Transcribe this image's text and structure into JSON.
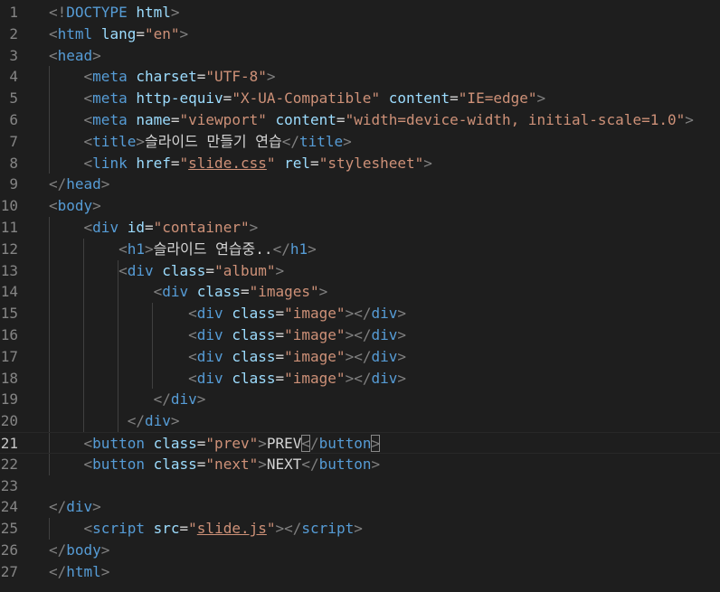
{
  "editor": {
    "language": "html",
    "active_line": 21,
    "colors": {
      "background": "#1e1e1e",
      "line_number": "#858585",
      "tag": "#569cd6",
      "attribute": "#9cdcfe",
      "string": "#ce9178",
      "punctuation": "#808080",
      "text": "#d4d4d4"
    },
    "lines": [
      {
        "number": "1",
        "tokens": [
          [
            "pun",
            "<!"
          ],
          [
            "tag",
            "DOCTYPE"
          ],
          [
            "text",
            " "
          ],
          [
            "attr",
            "html"
          ],
          [
            "pun",
            ">"
          ]
        ]
      },
      {
        "number": "2",
        "tokens": [
          [
            "pun",
            "<"
          ],
          [
            "tag",
            "html"
          ],
          [
            "text",
            " "
          ],
          [
            "attr",
            "lang"
          ],
          [
            "eq",
            "="
          ],
          [
            "str",
            "\"en\""
          ],
          [
            "pun",
            ">"
          ]
        ]
      },
      {
        "number": "3",
        "tokens": [
          [
            "pun",
            "<"
          ],
          [
            "tag",
            "head"
          ],
          [
            "pun",
            ">"
          ]
        ]
      },
      {
        "number": "4",
        "tokens": [
          [
            "text",
            "    "
          ],
          [
            "pun",
            "<"
          ],
          [
            "tag",
            "meta"
          ],
          [
            "text",
            " "
          ],
          [
            "attr",
            "charset"
          ],
          [
            "eq",
            "="
          ],
          [
            "str",
            "\"UTF-8\""
          ],
          [
            "pun",
            ">"
          ]
        ]
      },
      {
        "number": "5",
        "tokens": [
          [
            "text",
            "    "
          ],
          [
            "pun",
            "<"
          ],
          [
            "tag",
            "meta"
          ],
          [
            "text",
            " "
          ],
          [
            "attr",
            "http-equiv"
          ],
          [
            "eq",
            "="
          ],
          [
            "str",
            "\"X-UA-Compatible\""
          ],
          [
            "text",
            " "
          ],
          [
            "attr",
            "content"
          ],
          [
            "eq",
            "="
          ],
          [
            "str",
            "\"IE=edge\""
          ],
          [
            "pun",
            ">"
          ]
        ]
      },
      {
        "number": "6",
        "tokens": [
          [
            "text",
            "    "
          ],
          [
            "pun",
            "<"
          ],
          [
            "tag",
            "meta"
          ],
          [
            "text",
            " "
          ],
          [
            "attr",
            "name"
          ],
          [
            "eq",
            "="
          ],
          [
            "str",
            "\"viewport\""
          ],
          [
            "text",
            " "
          ],
          [
            "attr",
            "content"
          ],
          [
            "eq",
            "="
          ],
          [
            "str",
            "\"width=device-width, initial-scale=1.0\""
          ],
          [
            "pun",
            ">"
          ]
        ]
      },
      {
        "number": "7",
        "tokens": [
          [
            "text",
            "    "
          ],
          [
            "pun",
            "<"
          ],
          [
            "tag",
            "title"
          ],
          [
            "pun",
            ">"
          ],
          [
            "text",
            "슬라이드 만들기 연습"
          ],
          [
            "pun",
            "</"
          ],
          [
            "tag",
            "title"
          ],
          [
            "pun",
            ">"
          ]
        ]
      },
      {
        "number": "8",
        "tokens": [
          [
            "text",
            "    "
          ],
          [
            "pun",
            "<"
          ],
          [
            "tag",
            "link"
          ],
          [
            "text",
            " "
          ],
          [
            "attr",
            "href"
          ],
          [
            "eq",
            "="
          ],
          [
            "str",
            "\""
          ],
          [
            "link",
            "slide.css"
          ],
          [
            "str",
            "\""
          ],
          [
            "text",
            " "
          ],
          [
            "attr",
            "rel"
          ],
          [
            "eq",
            "="
          ],
          [
            "str",
            "\"stylesheet\""
          ],
          [
            "pun",
            ">"
          ]
        ]
      },
      {
        "number": "9",
        "tokens": [
          [
            "pun",
            "</"
          ],
          [
            "tag",
            "head"
          ],
          [
            "pun",
            ">"
          ]
        ]
      },
      {
        "number": "10",
        "tokens": [
          [
            "pun",
            "<"
          ],
          [
            "tag",
            "body"
          ],
          [
            "pun",
            ">"
          ]
        ]
      },
      {
        "number": "11",
        "tokens": [
          [
            "text",
            "    "
          ],
          [
            "pun",
            "<"
          ],
          [
            "tag",
            "div"
          ],
          [
            "text",
            " "
          ],
          [
            "attr",
            "id"
          ],
          [
            "eq",
            "="
          ],
          [
            "str",
            "\"container\""
          ],
          [
            "pun",
            ">"
          ]
        ]
      },
      {
        "number": "12",
        "tokens": [
          [
            "text",
            "        "
          ],
          [
            "pun",
            "<"
          ],
          [
            "tag",
            "h1"
          ],
          [
            "pun",
            ">"
          ],
          [
            "text",
            "슬라이드 연습중.."
          ],
          [
            "pun",
            "</"
          ],
          [
            "tag",
            "h1"
          ],
          [
            "pun",
            ">"
          ]
        ]
      },
      {
        "number": "13",
        "tokens": [
          [
            "text",
            "        "
          ],
          [
            "pun",
            "<"
          ],
          [
            "tag",
            "div"
          ],
          [
            "text",
            " "
          ],
          [
            "attr",
            "class"
          ],
          [
            "eq",
            "="
          ],
          [
            "str",
            "\"album\""
          ],
          [
            "pun",
            ">"
          ]
        ]
      },
      {
        "number": "14",
        "tokens": [
          [
            "text",
            "            "
          ],
          [
            "pun",
            "<"
          ],
          [
            "tag",
            "div"
          ],
          [
            "text",
            " "
          ],
          [
            "attr",
            "class"
          ],
          [
            "eq",
            "="
          ],
          [
            "str",
            "\"images\""
          ],
          [
            "pun",
            ">"
          ]
        ]
      },
      {
        "number": "15",
        "tokens": [
          [
            "text",
            "                "
          ],
          [
            "pun",
            "<"
          ],
          [
            "tag",
            "div"
          ],
          [
            "text",
            " "
          ],
          [
            "attr",
            "class"
          ],
          [
            "eq",
            "="
          ],
          [
            "str",
            "\"image\""
          ],
          [
            "pun",
            "></"
          ],
          [
            "tag",
            "div"
          ],
          [
            "pun",
            ">"
          ]
        ]
      },
      {
        "number": "16",
        "tokens": [
          [
            "text",
            "                "
          ],
          [
            "pun",
            "<"
          ],
          [
            "tag",
            "div"
          ],
          [
            "text",
            " "
          ],
          [
            "attr",
            "class"
          ],
          [
            "eq",
            "="
          ],
          [
            "str",
            "\"image\""
          ],
          [
            "pun",
            "></"
          ],
          [
            "tag",
            "div"
          ],
          [
            "pun",
            ">"
          ]
        ]
      },
      {
        "number": "17",
        "tokens": [
          [
            "text",
            "                "
          ],
          [
            "pun",
            "<"
          ],
          [
            "tag",
            "div"
          ],
          [
            "text",
            " "
          ],
          [
            "attr",
            "class"
          ],
          [
            "eq",
            "="
          ],
          [
            "str",
            "\"image\""
          ],
          [
            "pun",
            "></"
          ],
          [
            "tag",
            "div"
          ],
          [
            "pun",
            ">"
          ]
        ]
      },
      {
        "number": "18",
        "tokens": [
          [
            "text",
            "                "
          ],
          [
            "pun",
            "<"
          ],
          [
            "tag",
            "div"
          ],
          [
            "text",
            " "
          ],
          [
            "attr",
            "class"
          ],
          [
            "eq",
            "="
          ],
          [
            "str",
            "\"image\""
          ],
          [
            "pun",
            "></"
          ],
          [
            "tag",
            "div"
          ],
          [
            "pun",
            ">"
          ]
        ]
      },
      {
        "number": "19",
        "tokens": [
          [
            "text",
            "            "
          ],
          [
            "pun",
            "</"
          ],
          [
            "tag",
            "div"
          ],
          [
            "pun",
            ">"
          ]
        ]
      },
      {
        "number": "20",
        "tokens": [
          [
            "text",
            "         "
          ],
          [
            "pun",
            "</"
          ],
          [
            "tag",
            "div"
          ],
          [
            "pun",
            ">"
          ]
        ]
      },
      {
        "number": "21",
        "tokens": [
          [
            "text",
            "    "
          ],
          [
            "pun",
            "<"
          ],
          [
            "tag",
            "button"
          ],
          [
            "text",
            " "
          ],
          [
            "attr",
            "class"
          ],
          [
            "eq",
            "="
          ],
          [
            "str",
            "\"prev\""
          ],
          [
            "pun",
            ">"
          ],
          [
            "text",
            "PREV"
          ],
          [
            "cursor",
            "<"
          ],
          [
            "pun",
            "/"
          ],
          [
            "tag",
            "button"
          ],
          [
            "cursor",
            ">"
          ]
        ]
      },
      {
        "number": "22",
        "tokens": [
          [
            "text",
            "    "
          ],
          [
            "pun",
            "<"
          ],
          [
            "tag",
            "button"
          ],
          [
            "text",
            " "
          ],
          [
            "attr",
            "class"
          ],
          [
            "eq",
            "="
          ],
          [
            "str",
            "\"next\""
          ],
          [
            "pun",
            ">"
          ],
          [
            "text",
            "NEXT"
          ],
          [
            "pun",
            "</"
          ],
          [
            "tag",
            "button"
          ],
          [
            "pun",
            ">"
          ]
        ]
      },
      {
        "number": "23",
        "tokens": []
      },
      {
        "number": "24",
        "tokens": [
          [
            "pun",
            "</"
          ],
          [
            "tag",
            "div"
          ],
          [
            "pun",
            ">"
          ]
        ]
      },
      {
        "number": "25",
        "tokens": [
          [
            "text",
            "    "
          ],
          [
            "pun",
            "<"
          ],
          [
            "tag",
            "script"
          ],
          [
            "text",
            " "
          ],
          [
            "attr",
            "src"
          ],
          [
            "eq",
            "="
          ],
          [
            "str",
            "\""
          ],
          [
            "link",
            "slide.js"
          ],
          [
            "str",
            "\""
          ],
          [
            "pun",
            "></"
          ],
          [
            "tag",
            "script"
          ],
          [
            "pun",
            ">"
          ]
        ]
      },
      {
        "number": "26",
        "tokens": [
          [
            "pun",
            "</"
          ],
          [
            "tag",
            "body"
          ],
          [
            "pun",
            ">"
          ]
        ]
      },
      {
        "number": "27",
        "tokens": [
          [
            "pun",
            "</"
          ],
          [
            "tag",
            "html"
          ],
          [
            "pun",
            ">"
          ]
        ]
      }
    ]
  }
}
